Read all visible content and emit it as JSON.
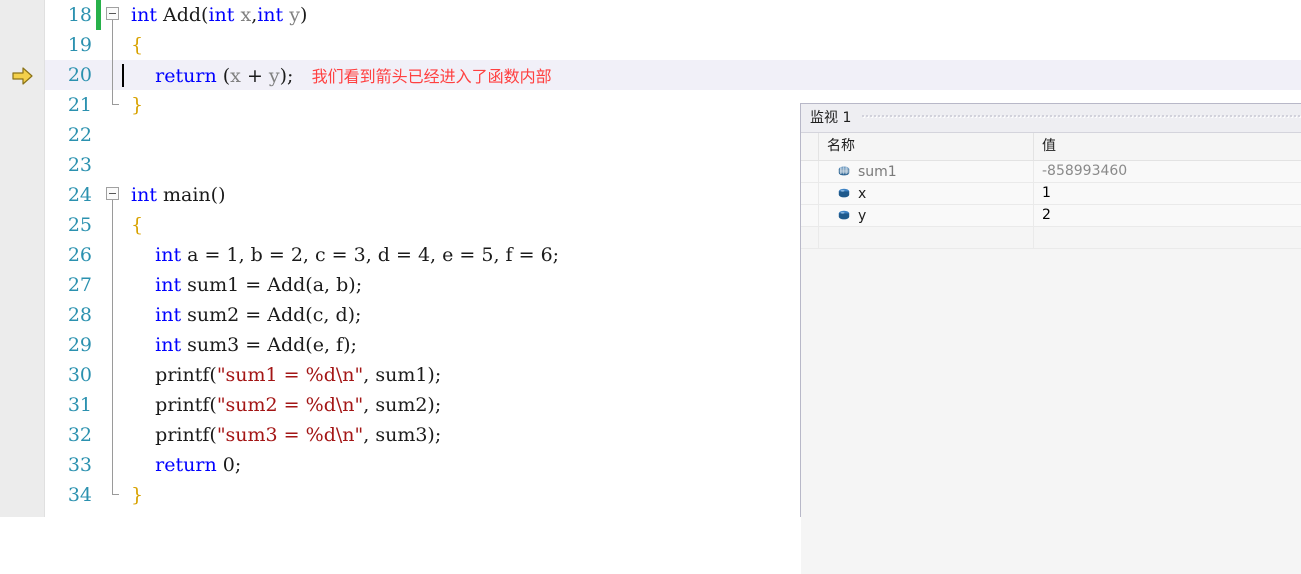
{
  "editor": {
    "current_line": 20,
    "execution_arrow_line": 20,
    "annotation": "我们看到箭头已经进入了函数内部",
    "lines": [
      {
        "num": "18",
        "text": "int Add(int x,int y)"
      },
      {
        "num": "19",
        "text": "{"
      },
      {
        "num": "20",
        "text": "return (x + y);"
      },
      {
        "num": "21",
        "text": "}"
      },
      {
        "num": "22",
        "text": ""
      },
      {
        "num": "23",
        "text": ""
      },
      {
        "num": "24",
        "text": "int main()"
      },
      {
        "num": "25",
        "text": "{"
      },
      {
        "num": "26",
        "text": "int a = 1, b = 2, c = 3, d = 4, e = 5, f = 6;"
      },
      {
        "num": "27",
        "text": "int sum1 = Add(a, b);"
      },
      {
        "num": "28",
        "text": "int sum2 = Add(c, d);"
      },
      {
        "num": "29",
        "text": "int sum3 = Add(e, f);"
      },
      {
        "num": "30",
        "text": "printf(\"sum1 = %d\\n\", sum1);"
      },
      {
        "num": "31",
        "text": "printf(\"sum2 = %d\\n\", sum2);"
      },
      {
        "num": "32",
        "text": "printf(\"sum3 = %d\\n\", sum3);"
      },
      {
        "num": "33",
        "text": "return 0;"
      },
      {
        "num": "34",
        "text": "}"
      }
    ],
    "tokens": {
      "kw_int": "int",
      "kw_return": "return",
      "fn_add": "Add",
      "fn_main": "main",
      "fn_printf": "printf"
    },
    "colors": {
      "keyword": "#0000ff",
      "string": "#a31515",
      "inactive_identifier": "#808080",
      "brace": "#d8a200",
      "line_number": "#2b91af",
      "annotation": "#ff4040",
      "change_bar": "#27b14a",
      "current_line_bg": "#f1f0f8",
      "exec_arrow": "#f3d04a"
    }
  },
  "watch": {
    "tab_label": "监视 1",
    "columns": {
      "name": "名称",
      "value": "值"
    },
    "rows": [
      {
        "icon": "field-grid-icon",
        "name": "sum1",
        "value": "-858993460",
        "dim": true
      },
      {
        "icon": "field-box-icon",
        "name": "x",
        "value": "1",
        "dim": false
      },
      {
        "icon": "field-box-icon",
        "name": "y",
        "value": "2",
        "dim": false
      }
    ]
  }
}
